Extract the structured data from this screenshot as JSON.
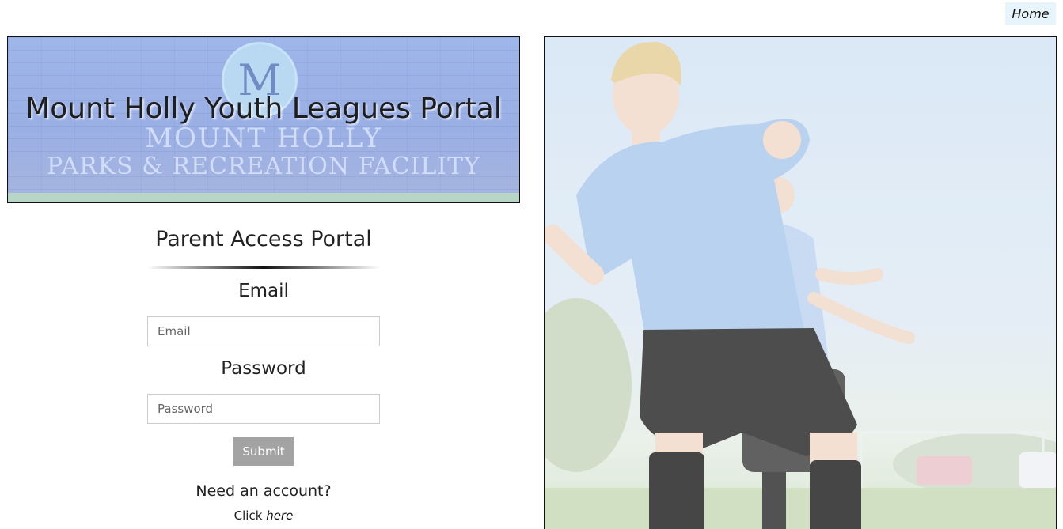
{
  "nav": {
    "home_label": "Home"
  },
  "banner": {
    "title": "Mount Holly Youth Leagues Portal",
    "sign_line_1": "MOUNT HOLLY",
    "sign_line_2": "PARKS & RECREATION FACILITY",
    "logo_letter": "M"
  },
  "form": {
    "heading": "Parent Access Portal",
    "email_label": "Email",
    "email_placeholder": "Email",
    "email_value": "",
    "password_label": "Password",
    "password_placeholder": "Password",
    "password_value": "",
    "submit_label": "Submit",
    "need_account": "Need an account?",
    "click_prefix": "Click",
    "here_link": "here"
  },
  "photo": {
    "icon": "soccer-player-photo"
  },
  "colors": {
    "banner_bg": "#9fb6ea",
    "home_bg": "#e8f4fb",
    "submit_bg": "#a3a3a3",
    "jersey": "#a9c8ec"
  }
}
